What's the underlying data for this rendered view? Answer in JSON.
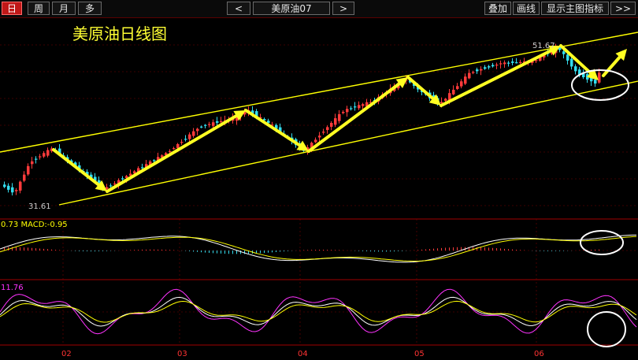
{
  "toolbar": {
    "periods": [
      "日",
      "周",
      "月",
      "多"
    ],
    "prev_label": "<",
    "next_label": ">",
    "symbol": "美原油07",
    "tools": [
      "叠加",
      "画线",
      "显示主图指标",
      ">>"
    ]
  },
  "colors": {
    "up": "#ff3b3b",
    "down": "#33ddee",
    "channel": "#ffff00",
    "arrow": "#ffff22",
    "title": "#ffff33",
    "macd_fast": "#ffffff",
    "macd_slow": "#ffff00",
    "kdj_k": "#ffffff",
    "kdj_d": "#ffff00",
    "kdj_j": "#ff33ff",
    "grid": "#7a0000",
    "date_label": "#ff3333"
  },
  "chart_data": [
    {
      "type": "candlestick",
      "title": "美原油日线图",
      "high_label": "51.67",
      "low_label": "31.61",
      "ylim": [
        29,
        54
      ],
      "annotations": [
        "ascending-channel",
        "zigzag-arrows",
        "circle-latest-candles",
        "breakout-arrow"
      ]
    },
    {
      "type": "line",
      "title": "0.73 MACD:-0.95",
      "series": [
        "DIF",
        "DEA",
        "MACD histogram"
      ],
      "annotations": [
        "circle-latest-values"
      ]
    },
    {
      "type": "line",
      "title": "11.76",
      "series": [
        "K",
        "D",
        "J"
      ],
      "annotations": [
        "circle-latest-values"
      ]
    }
  ],
  "x_axis": {
    "labels": [
      "02",
      "03",
      "04",
      "05",
      "06"
    ]
  }
}
